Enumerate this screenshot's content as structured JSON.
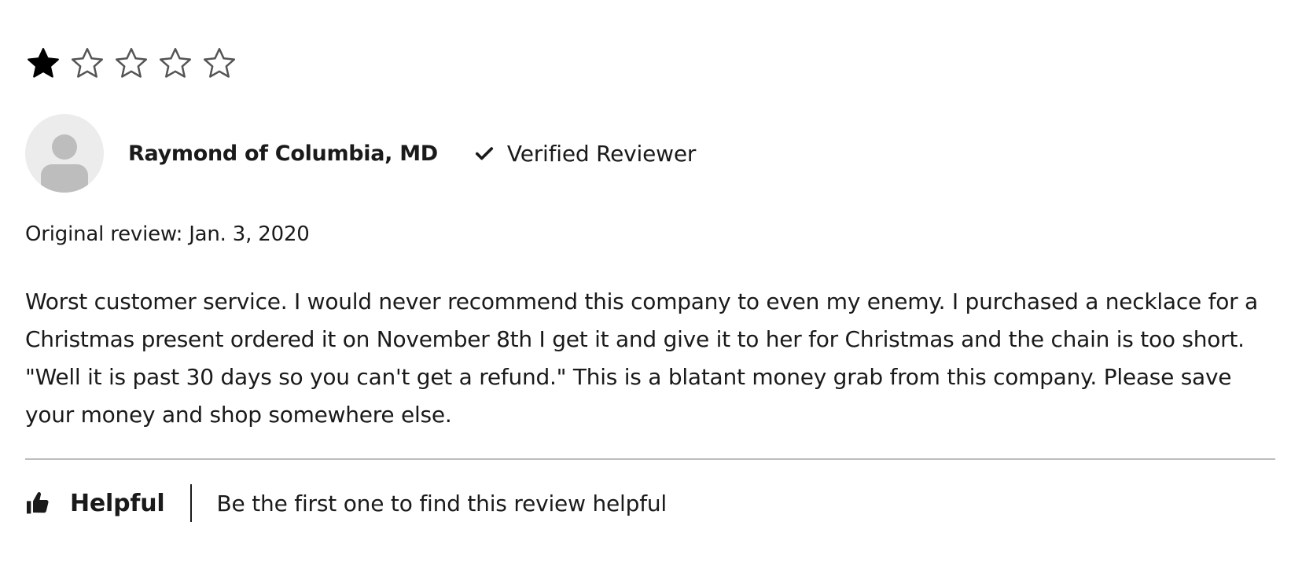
{
  "rating": {
    "value": 1,
    "max": 5,
    "filled_icon": "star-filled-icon",
    "empty_icon": "star-outline-icon"
  },
  "reviewer": {
    "name": "Raymond of Columbia, MD",
    "avatar_icon": "default-avatar-icon",
    "verified_icon": "checkmark-icon",
    "verified_label": "Verified Reviewer"
  },
  "review": {
    "date": "Original review: Jan. 3, 2020",
    "body": "Worst customer service. I would never recommend this company to even my enemy. I purchased a necklace for a Christmas present ordered it on November 8th I get it and give it to her for Christmas and the chain is too short. \"Well it is past 30 days so you can't get a refund.\" This is a blatant money grab from this company. Please save your money and shop somewhere else."
  },
  "helpful": {
    "icon": "thumbs-up-icon",
    "label": "Helpful",
    "prompt": "Be the first one to find this review helpful"
  },
  "colors": {
    "text": "#1a1a1a",
    "star_filled": "#000000",
    "star_outline": "#555555",
    "avatar_bg": "#ececec",
    "avatar_figure": "#bdbdbd",
    "divider": "#bdbdbd"
  }
}
